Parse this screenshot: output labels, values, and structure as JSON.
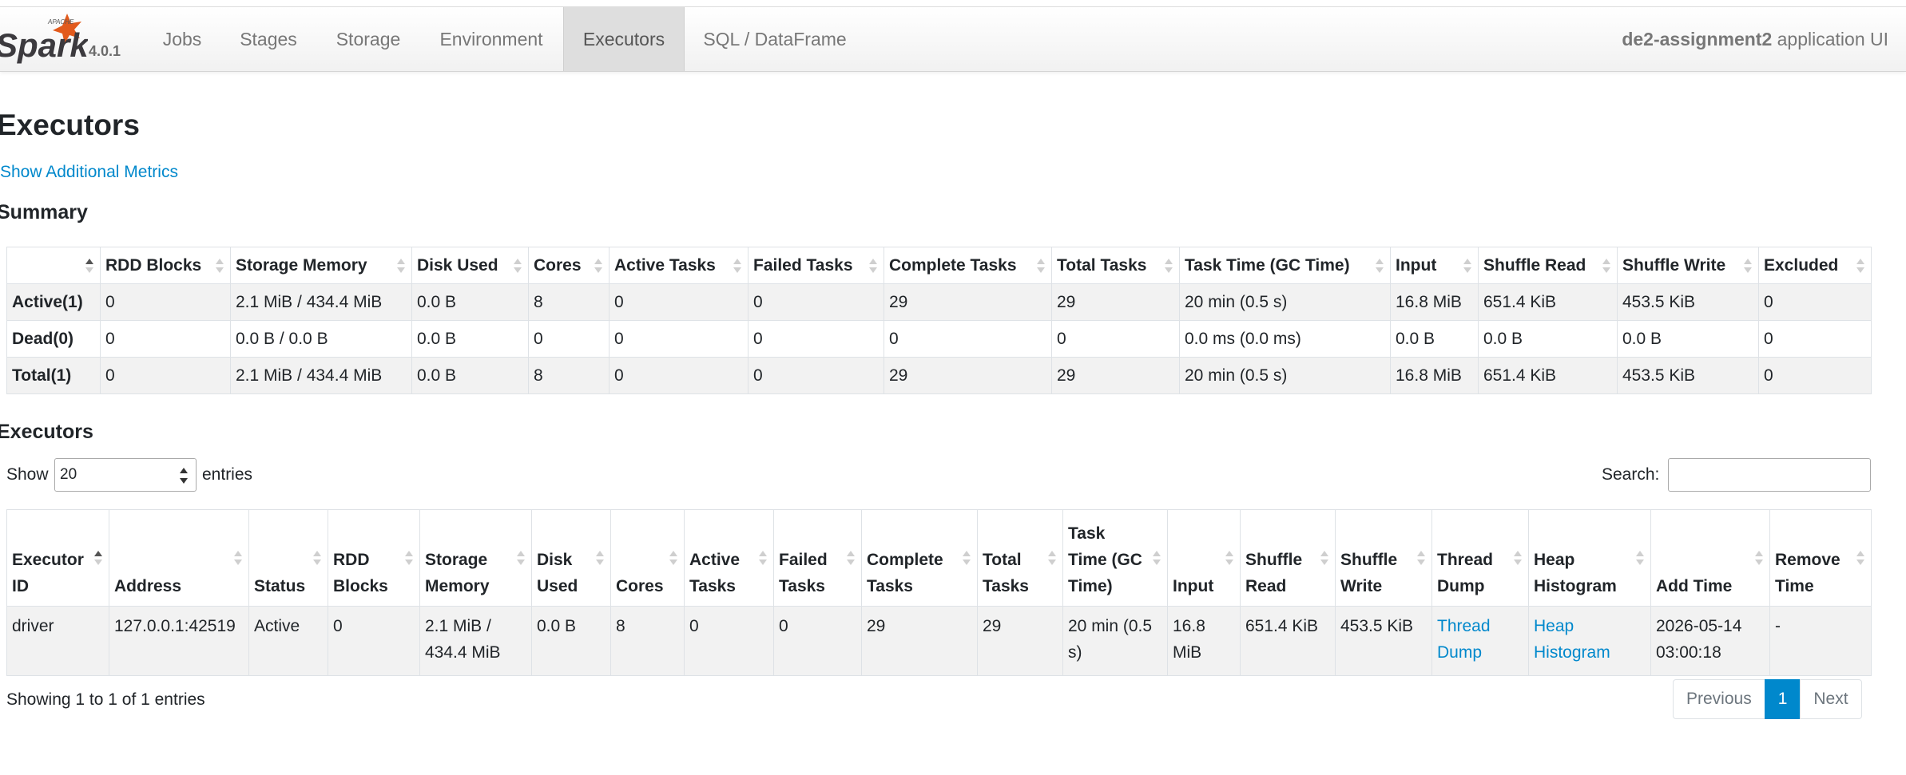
{
  "navbar": {
    "logo_top_text": "APACHE",
    "logo_text": "Spark",
    "version": "4.0.1",
    "tabs": [
      {
        "label": "Jobs"
      },
      {
        "label": "Stages"
      },
      {
        "label": "Storage"
      },
      {
        "label": "Environment"
      },
      {
        "label": "Executors"
      },
      {
        "label": "SQL / DataFrame"
      }
    ],
    "active_tab": "Executors",
    "app_name": "de2-assignment2",
    "app_suffix": "application UI"
  },
  "page": {
    "title": "Executors",
    "additional_metrics_link": "Show Additional Metrics",
    "summary_heading": "Summary",
    "executors_heading": "Executors"
  },
  "summary": {
    "headers": [
      "",
      "RDD Blocks",
      "Storage Memory",
      "Disk Used",
      "Cores",
      "Active Tasks",
      "Failed Tasks",
      "Complete Tasks",
      "Total Tasks",
      "Task Time (GC Time)",
      "Input",
      "Shuffle Read",
      "Shuffle Write",
      "Excluded"
    ],
    "rows": [
      [
        "Active(1)",
        "0",
        "2.1 MiB / 434.4 MiB",
        "0.0 B",
        "8",
        "0",
        "0",
        "29",
        "29",
        "20 min (0.5 s)",
        "16.8 MiB",
        "651.4 KiB",
        "453.5 KiB",
        "0"
      ],
      [
        "Dead(0)",
        "0",
        "0.0 B / 0.0 B",
        "0.0 B",
        "0",
        "0",
        "0",
        "0",
        "0",
        "0.0 ms (0.0 ms)",
        "0.0 B",
        "0.0 B",
        "0.0 B",
        "0"
      ],
      [
        "Total(1)",
        "0",
        "2.1 MiB / 434.4 MiB",
        "0.0 B",
        "8",
        "0",
        "0",
        "29",
        "29",
        "20 min (0.5 s)",
        "16.8 MiB",
        "651.4 KiB",
        "453.5 KiB",
        "0"
      ]
    ]
  },
  "controls": {
    "show_label": "Show",
    "page_length": "20",
    "entries_label": "entries",
    "search_label": "Search:",
    "search_value": ""
  },
  "executors": {
    "headers": [
      "Executor ID",
      "Address",
      "Status",
      "RDD Blocks",
      "Storage Memory",
      "Disk Used",
      "Cores",
      "Active Tasks",
      "Failed Tasks",
      "Complete Tasks",
      "Total Tasks",
      "Task Time (GC Time)",
      "Input",
      "Shuffle Read",
      "Shuffle Write",
      "Thread Dump",
      "Heap Histogram",
      "Add Time",
      "Remove Time"
    ],
    "rows": [
      [
        "driver",
        "127.0.0.1:42519",
        "Active",
        "0",
        "2.1 MiB / 434.4 MiB",
        "0.0 B",
        "8",
        "0",
        "0",
        "29",
        "29",
        "20 min (0.5 s)",
        "16.8 MiB",
        "651.4 KiB",
        "453.5 KiB",
        "Thread Dump",
        "Heap Histogram",
        "2026-05-14 03:00:18",
        "-"
      ]
    ]
  },
  "footer": {
    "info": "Showing 1 to 1 of 1 entries",
    "previous": "Previous",
    "current_page": "1",
    "next": "Next"
  },
  "colors": {
    "link": "#0088cc",
    "active_page": "#0088cc",
    "logo_orange": "#e25a1c",
    "striped_row": "#f2f2f2"
  }
}
